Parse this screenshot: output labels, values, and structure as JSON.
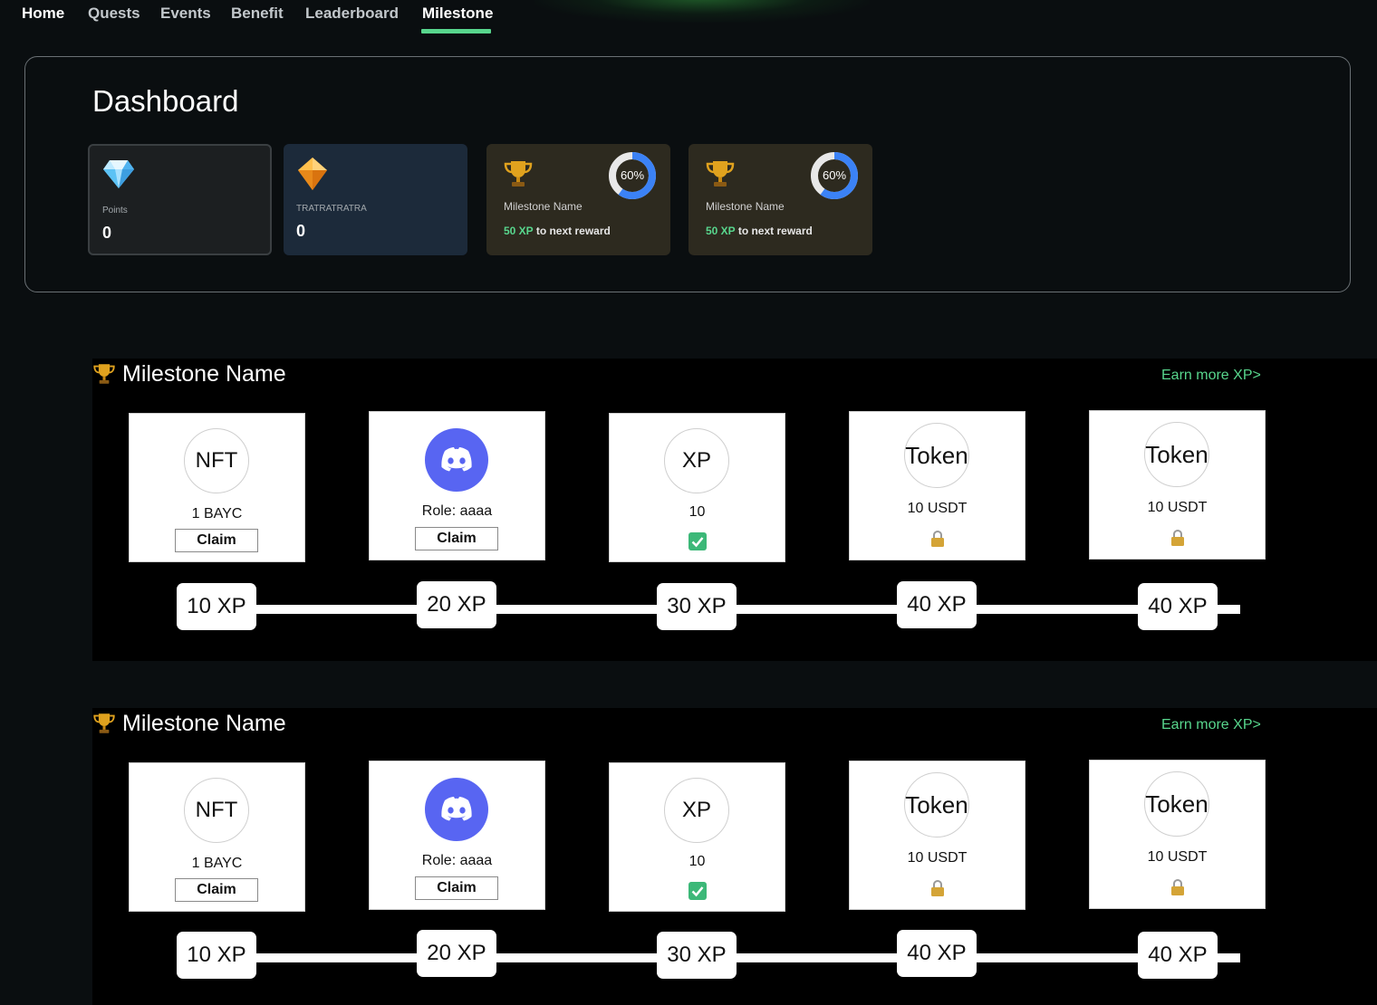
{
  "nav": {
    "tabs": [
      {
        "label": "Home"
      },
      {
        "label": "Quests"
      },
      {
        "label": "Events"
      },
      {
        "label": "Benefit"
      },
      {
        "label": "Leaderboard"
      },
      {
        "label": "Milestone"
      }
    ],
    "active": "Milestone"
  },
  "dashboard": {
    "title": "Dashboard",
    "stats": [
      {
        "label": "Points",
        "value": "0",
        "icon": "diamond-icon"
      },
      {
        "label": "TRATRATRATRA",
        "value": "0",
        "icon": "orange-gem-icon"
      }
    ],
    "milestones": [
      {
        "name": "Milestone Name",
        "progress_text": "60%",
        "progress": 0.6,
        "xp": "50 XP",
        "next_text": " to next reward",
        "icon": "trophy-icon"
      },
      {
        "name": "Milestone Name",
        "progress_text": "60%",
        "progress": 0.6,
        "xp": "50 XP",
        "next_text": " to next reward",
        "icon": "trophy-icon"
      }
    ]
  },
  "sections": [
    {
      "title": "Milestone Name",
      "earn_link": "Earn more XP>",
      "rewards": [
        {
          "badge": "NFT",
          "desc": "1 BAYC",
          "claim_label": "Claim",
          "status": "claim"
        },
        {
          "badge": "",
          "icon": "discord-icon",
          "desc": "Role: aaaa",
          "claim_label": "Claim",
          "status": "claim"
        },
        {
          "badge": "XP",
          "desc": "10",
          "status": "done",
          "status_icon": "check-icon"
        },
        {
          "badge": "Token",
          "desc": "10 USDT",
          "status": "locked",
          "status_icon": "lock-icon"
        },
        {
          "badge": "Token",
          "desc": "10 USDT",
          "status": "locked",
          "status_icon": "lock-icon"
        }
      ],
      "thresholds": [
        "10 XP",
        "20 XP",
        "30 XP",
        "40 XP",
        "40 XP"
      ]
    },
    {
      "title": "Milestone Name",
      "earn_link": "Earn more XP>",
      "rewards": [
        {
          "badge": "NFT",
          "desc": "1 BAYC",
          "claim_label": "Claim",
          "status": "claim"
        },
        {
          "badge": "",
          "icon": "discord-icon",
          "desc": "Role: aaaa",
          "claim_label": "Claim",
          "status": "claim"
        },
        {
          "badge": "XP",
          "desc": "10",
          "status": "done",
          "status_icon": "check-icon"
        },
        {
          "badge": "Token",
          "desc": "10 USDT",
          "status": "locked",
          "status_icon": "lock-icon"
        },
        {
          "badge": "Token",
          "desc": "10 USDT",
          "status": "locked",
          "status_icon": "lock-icon"
        }
      ],
      "thresholds": [
        "10 XP",
        "20 XP",
        "30 XP",
        "40 XP",
        "40 XP"
      ]
    }
  ],
  "colors": {
    "accent": "#58d68d",
    "background": "#0a0e10",
    "ring": "#3b82f6",
    "discord": "#5865f2"
  }
}
